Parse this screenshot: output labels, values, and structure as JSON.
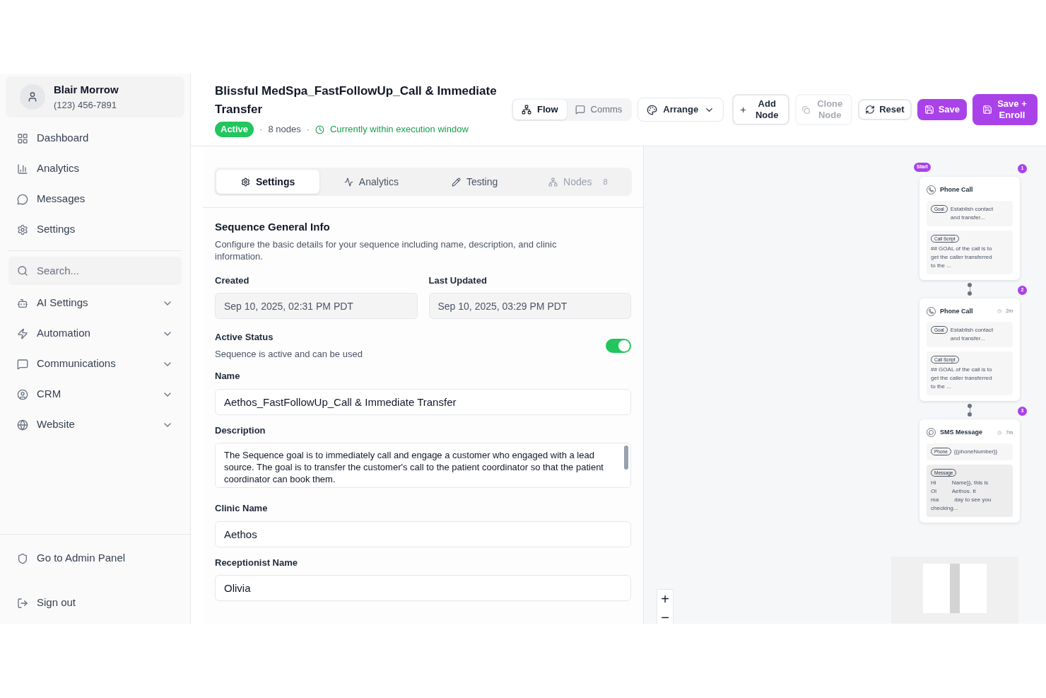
{
  "sidebar": {
    "user": {
      "name": "Blair Morrow",
      "phone": "(123) 456-7891"
    },
    "items": [
      {
        "kind": "link",
        "label": "Dashboard"
      },
      {
        "kind": "link",
        "label": "Analytics"
      },
      {
        "kind": "link",
        "label": "Messages"
      },
      {
        "kind": "link",
        "label": "Settings"
      },
      {
        "kind": "search",
        "placeholder": "Search..."
      },
      {
        "kind": "group",
        "label": "AI Settings",
        "expanded": false
      },
      {
        "kind": "group",
        "label": "Automation",
        "expanded": false
      },
      {
        "kind": "group",
        "label": "Communications",
        "expanded": false
      },
      {
        "kind": "group",
        "label": "CRM",
        "expanded": false
      },
      {
        "kind": "group",
        "label": "Website",
        "expanded": false
      }
    ],
    "footer": [
      {
        "label": "Go to Admin Panel"
      },
      {
        "label": "Sign out"
      }
    ]
  },
  "header": {
    "title": "Blissful MedSpa_FastFollowUp_Call & Immediate Transfer",
    "status": "Active",
    "separator": "·",
    "node_count": "8 nodes",
    "window_status": "Currently within execution window",
    "view_toggle": [
      {
        "label": "Flow",
        "selected": true
      },
      {
        "label": "Comms",
        "selected": false
      }
    ],
    "arrange": "Arrange",
    "buttons": [
      {
        "label": "Add Node",
        "kind": "outline",
        "disabled": false
      },
      {
        "label": "Clone Node",
        "kind": "outline",
        "disabled": true
      },
      {
        "label": "Reset",
        "kind": "outline",
        "disabled": false
      },
      {
        "label": "Save",
        "kind": "primary",
        "disabled": false
      },
      {
        "label": "Save + Enroll",
        "kind": "primary",
        "disabled": false
      }
    ]
  },
  "tabs": [
    {
      "label": "Settings",
      "selected": true,
      "disabled": false
    },
    {
      "label": "Analytics",
      "selected": false,
      "disabled": false
    },
    {
      "label": "Testing",
      "selected": false,
      "disabled": false
    },
    {
      "label": "Nodes",
      "selected": false,
      "disabled": true,
      "count": "8"
    }
  ],
  "settings": {
    "title": "Sequence General Info",
    "description": "Configure the basic details for your sequence including name, description, and clinic information.",
    "dates": [
      {
        "label": "Created",
        "value": "Sep 10, 2025, 02:31 PM PDT"
      },
      {
        "label": "Last Updated",
        "value": "Sep 10, 2025, 03:29 PM PDT"
      }
    ],
    "active_status": {
      "label": "Active Status",
      "description": "Sequence is active and can be used",
      "on": true
    },
    "name": {
      "label": "Name",
      "value": "Aethos_FastFollowUp_Call & Immediate Transfer"
    },
    "description_field": {
      "label": "Description",
      "value": "The Sequence goal is to immediately call and engage a customer who engaged with a lead source. The goal is to transfer the customer's call to the patient coordinator so that the patient coordinator can book them."
    },
    "clinic_name": {
      "label": "Clinic Name",
      "value": "Aethos"
    },
    "receptionist_name": {
      "label": "Receptionist Name",
      "value": "Olivia"
    }
  },
  "canvas": {
    "nodes": [
      {
        "number": "1",
        "start_label": "Start",
        "kind": "call",
        "title": "Phone Call",
        "items": [
          {
            "tag": "Goal",
            "lines": [
              "Establish contact",
              "and transfer..."
            ]
          },
          {
            "tag": "Call Script",
            "lines": [
              "## GOAL of the call is to",
              "get the caller transferred",
              "to the ..."
            ]
          }
        ]
      },
      {
        "number": "2",
        "kind": "call",
        "title": "Phone Call",
        "delay": "2m",
        "items": [
          {
            "tag": "Goal",
            "lines": [
              "Establish contact",
              "and transfer..."
            ]
          },
          {
            "tag": "Call Script",
            "lines": [
              "## GOAL of the call is to",
              "get the caller transferred",
              "to the ..."
            ]
          }
        ]
      },
      {
        "number": "3",
        "kind": "sms",
        "title": "SMS Message",
        "delay": "7m",
        "items": [
          {
            "tag": "Phone",
            "lines": [
              "{{phoneNumber}}"
            ]
          },
          {
            "tag": "Message",
            "lines": [
              "Hi          Name}}, this is",
              "Ol          Aethos. It",
              "ma          day to see you",
              "checking..."
            ]
          }
        ]
      }
    ],
    "zoom": [
      "+",
      "−"
    ]
  }
}
